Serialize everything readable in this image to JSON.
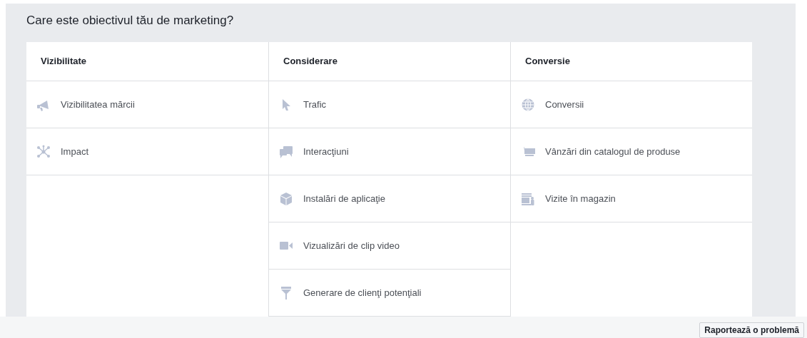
{
  "heading": "Care este obiectivul tău de marketing?",
  "columns": [
    {
      "title": "Vizibilitate",
      "items": [
        {
          "label": "Vizibilitatea mărcii",
          "kind": "megaphone"
        },
        {
          "label": "Impact",
          "kind": "network"
        }
      ]
    },
    {
      "title": "Considerare",
      "items": [
        {
          "label": "Trafic",
          "kind": "cursor"
        },
        {
          "label": "Interacţiuni",
          "kind": "chat"
        },
        {
          "label": "Instalări de aplicaţie",
          "kind": "cube"
        },
        {
          "label": "Vizualizări de clip video",
          "kind": "video"
        },
        {
          "label": "Generare de clienţi potenţiali",
          "kind": "funnel"
        }
      ]
    },
    {
      "title": "Conversie",
      "items": [
        {
          "label": "Conversii",
          "kind": "globe"
        },
        {
          "label": "Vânzări din catalogul de produse",
          "kind": "cart"
        },
        {
          "label": "Vizite în magazin",
          "kind": "store"
        }
      ]
    }
  ],
  "footer": {
    "button": "Raportează o problemă"
  }
}
